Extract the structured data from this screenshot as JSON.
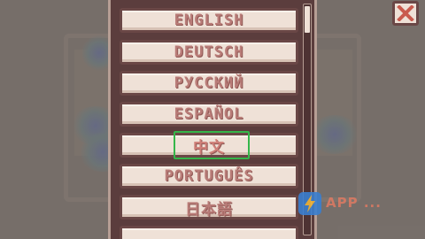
{
  "language_menu": {
    "items": [
      {
        "label": "ENGLISH",
        "selected": false
      },
      {
        "label": "DEUTSCH",
        "selected": false
      },
      {
        "label": "РУССКИЙ",
        "selected": false
      },
      {
        "label": "ESPAÑOL",
        "selected": false
      },
      {
        "label": "中文",
        "selected": true
      },
      {
        "label": "PORTUGUÊS",
        "selected": false
      },
      {
        "label": "日本語",
        "selected": false
      }
    ],
    "highlight_color": "#35b64a"
  },
  "close_button": {
    "icon": "close-icon",
    "color": "#c95b4e"
  },
  "watermark": {
    "text": "APP ...",
    "icon": "lightning-logo-icon"
  },
  "colors": {
    "button_fill": "#efe1d7",
    "button_border": "#6a4746",
    "label_text": "#b97c78",
    "panel_background": "#5b3d3d"
  }
}
